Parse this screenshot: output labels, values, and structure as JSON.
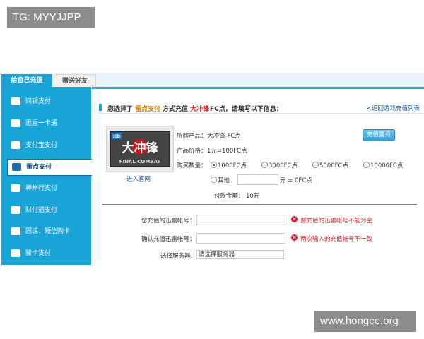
{
  "watermarks": {
    "top_left": "TG: MYYJJPP",
    "bottom_right": "www.hongce.org"
  },
  "tabs": [
    {
      "label": "给自己充值",
      "active": true
    },
    {
      "label": "赠送好友",
      "active": false
    }
  ],
  "sidebar": {
    "items": [
      {
        "label": "网银支付",
        "icon": "bank-card-icon"
      },
      {
        "label": "迅雷一卡通",
        "icon": "card-icon"
      },
      {
        "label": "支付宝支付",
        "icon": "alipay-icon"
      },
      {
        "label": "雷点支付",
        "icon": "thunder-icon",
        "active": true
      },
      {
        "label": "神州行支付",
        "icon": "mobile-icon"
      },
      {
        "label": "财付通支付",
        "icon": "tenpay-icon"
      },
      {
        "label": "固话、短信购卡",
        "icon": "phone-icon"
      },
      {
        "label": "骏卡支付",
        "icon": "junka-icon"
      }
    ]
  },
  "info": {
    "part1": "您选择了",
    "method": "雷点支付",
    "part2": "方式充值",
    "game": "大冲锋",
    "part3": "FC点，请填写以下信息：",
    "back_link": "≺返回游戏充值列表"
  },
  "product": {
    "logo_text": "大冲锋",
    "logo_sub": "FINAL COMBAT",
    "logo_badge": "HD",
    "enter_link": "进入官网",
    "purchase_label": "所购产品：",
    "purchase_value": "大冲锋-FC点",
    "price_label": "产品价格：",
    "price_value": "1元=100FC点",
    "qty_label": "购买数量：",
    "options": [
      "1000FC点",
      "3000FC点",
      "5000FC点",
      "10000FC点"
    ],
    "other_label": "其他",
    "other_suffix": "元 = 0FC点",
    "amount_label": "付款金额：",
    "amount_value": "10元",
    "recharge_button": "充值雷点"
  },
  "form": {
    "account_label": "您充值的迅雷帐号：",
    "account_error": "要充值的迅雷帐号不能为空",
    "confirm_label": "确认充值迅雷帐号：",
    "confirm_error": "两次输入的充值帐号不一致",
    "server_label": "选择服务器：",
    "server_value": "请选择服务器",
    "error_icon": "×"
  },
  "colors": {
    "accent": "#1ba3d6",
    "error": "#d2232a",
    "highlight_orange": "#e07a00",
    "highlight_red": "#d21f1f"
  }
}
